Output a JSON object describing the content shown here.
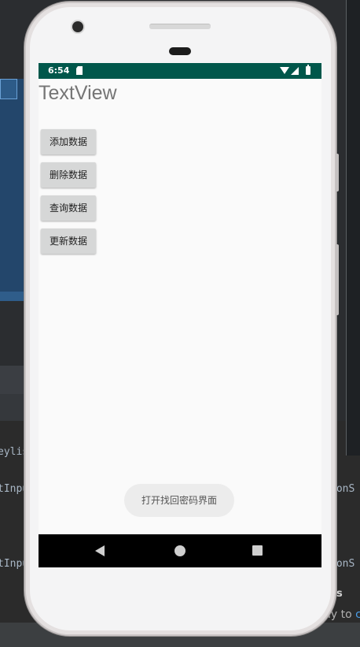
{
  "ide": {
    "console_lines": [
      "eylis",
      "tInpu",
      "tInpu"
    ],
    "right_lines": [
      "ionS",
      "ionS"
    ],
    "bold_fragment": "s",
    "ready_prefix": "dy to",
    "ready_link": "c"
  },
  "status_bar": {
    "time": "6:54",
    "color": "#00574b",
    "icons": [
      "sd-card-icon",
      "wifi-icon",
      "signal-icon",
      "battery-icon"
    ]
  },
  "app": {
    "title": "TextView",
    "buttons": [
      {
        "label": "添加数据"
      },
      {
        "label": "删除数据"
      },
      {
        "label": "查询数据"
      },
      {
        "label": "更新数据"
      }
    ],
    "toast": "打开找回密码界面"
  },
  "nav_bar": {
    "icons": [
      "back-icon",
      "home-icon",
      "recents-icon"
    ]
  }
}
